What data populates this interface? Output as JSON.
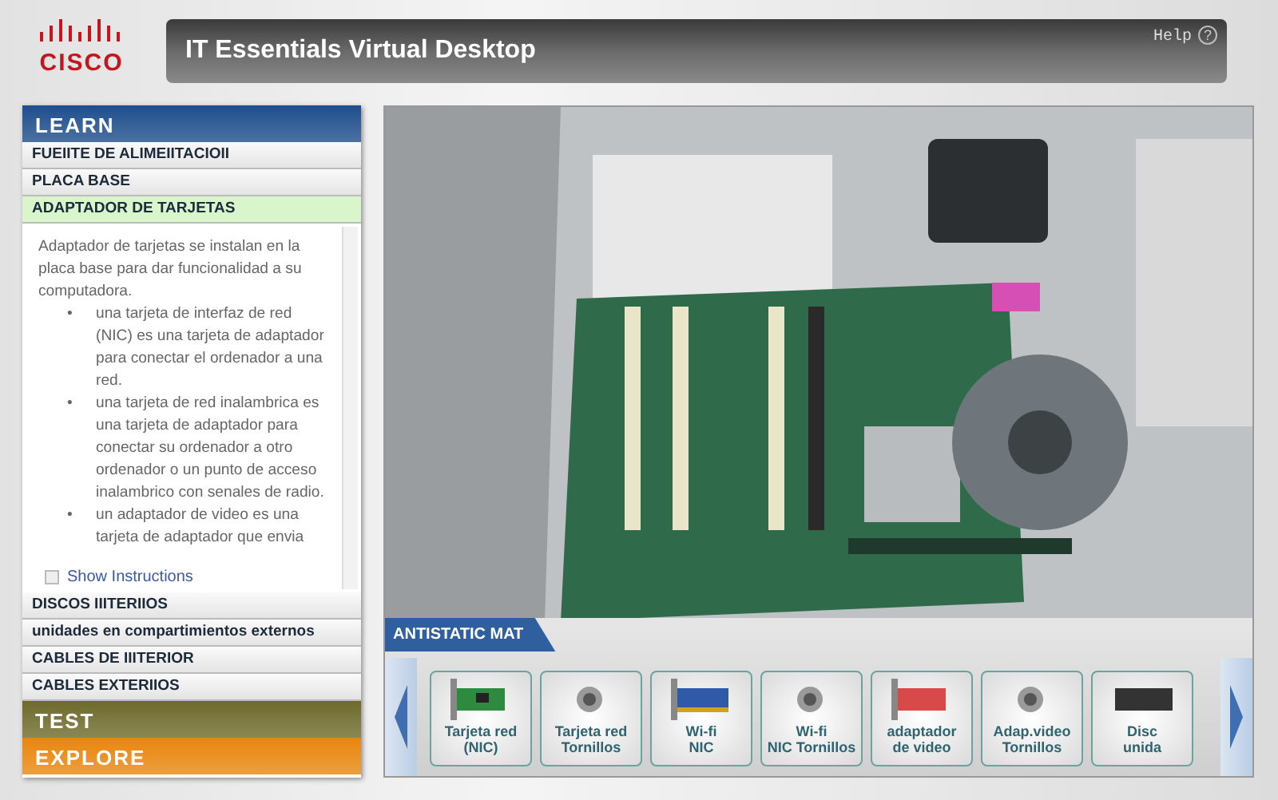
{
  "header": {
    "logo": "CISCO",
    "title": "IT Essentials Virtual Desktop",
    "help": "Help",
    "help_icon": "?"
  },
  "sidebar": {
    "sections": [
      {
        "label": "LEARN",
        "color": "#1f4e8c",
        "items": [
          {
            "label": "FUEIITE DE ALIMEIITACIOII",
            "selected": false
          },
          {
            "label": "PLACA BASE",
            "selected": false
          },
          {
            "label": "ADAPTADOR DE TARJETAS",
            "selected": true
          },
          {
            "label": "DISCOS IIITERIIOS",
            "selected": false
          },
          {
            "label": "unidades en compartimientos externos",
            "selected": false
          },
          {
            "label": "CABLES DE IIITERIOR",
            "selected": false
          },
          {
            "label": "CABLES EXTERIIOS",
            "selected": false
          }
        ]
      },
      {
        "label": "TEST",
        "color": "#6e6a2c"
      },
      {
        "label": "EXPLORE",
        "color": "#e8860e"
      }
    ],
    "content": {
      "marker": "•",
      "intro": "Adaptador de tarjetas se instalan en la placa base para dar funcionalidad a su computadora.",
      "bullets": [
        "una tarjeta de interfaz de red (NIC) es una tarjeta de adaptador para conectar el ordenador a una red.",
        "una tarjeta de red inalambrica es una tarjeta de adaptador para conectar su ordenador a otro ordenador o un punto de acceso inalambrico con senales de radio.",
        "un adaptador de video es una tarjeta de adaptador que envia"
      ],
      "show_instructions": {
        "label": "Show Instructions",
        "checked": false
      }
    }
  },
  "mat": {
    "title": "ANTISTATIC MAT",
    "items": [
      {
        "kind": "nic",
        "lines": [
          "Tarjeta red",
          "(NIC)"
        ]
      },
      {
        "kind": "screw",
        "lines": [
          "Tarjeta red",
          "Tornillos"
        ]
      },
      {
        "kind": "wifi",
        "lines": [
          "Wi-fi",
          "NIC"
        ]
      },
      {
        "kind": "screw",
        "lines": [
          "Wi-fi",
          "NIC Tornillos"
        ]
      },
      {
        "kind": "video",
        "lines": [
          "adaptador",
          "de video"
        ]
      },
      {
        "kind": "screw",
        "lines": [
          "Adap.video",
          "Tornillos"
        ]
      },
      {
        "kind": "drive",
        "lines": [
          "Disc",
          "unida"
        ]
      }
    ]
  }
}
